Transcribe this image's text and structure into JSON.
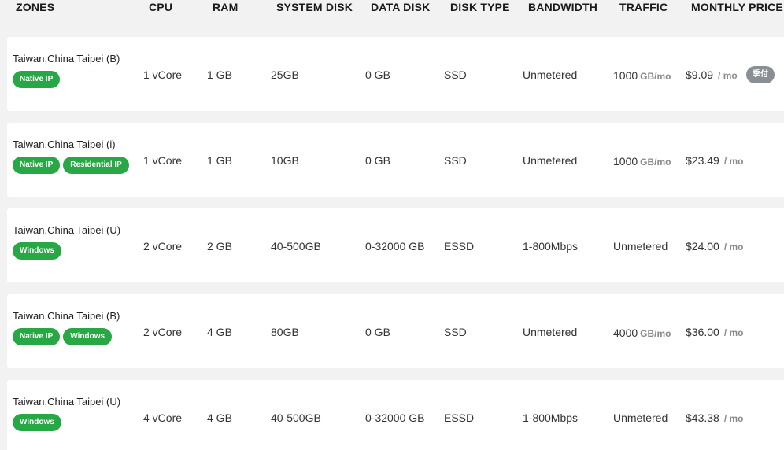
{
  "header": {
    "zones": "ZONES",
    "cpu": "CPU",
    "ram": "RAM",
    "system_disk": "SYSTEM DISK",
    "data_disk": "DATA DISK",
    "disk_type": "DISK TYPE",
    "bandwidth": "BANDWIDTH",
    "traffic": "TRAFFIC",
    "monthly_price": "MONTHLY PRICE"
  },
  "rows": [
    {
      "zone": "Taiwan,China Taipei (B)",
      "tags": [
        "Native IP"
      ],
      "cpu": "1 vCore",
      "ram": "1 GB",
      "system_disk": "25GB",
      "data_disk": "0 GB",
      "disk_type": "SSD",
      "bandwidth": "Unmetered",
      "traffic": "1000",
      "traffic_unit": "GB/mo",
      "price": "$9.09",
      "price_unit": "/ mo",
      "badge": "季付"
    },
    {
      "zone": "Taiwan,China Taipei (i)",
      "tags": [
        "Native IP",
        "Residential IP"
      ],
      "cpu": "1 vCore",
      "ram": "1 GB",
      "system_disk": "10GB",
      "data_disk": "0 GB",
      "disk_type": "SSD",
      "bandwidth": "Unmetered",
      "traffic": "1000",
      "traffic_unit": "GB/mo",
      "price": "$23.49",
      "price_unit": "/ mo",
      "badge": ""
    },
    {
      "zone": "Taiwan,China Taipei (U)",
      "tags": [
        "Windows"
      ],
      "cpu": "2 vCore",
      "ram": "2 GB",
      "system_disk": "40-500GB",
      "data_disk": "0-32000 GB",
      "disk_type": "ESSD",
      "bandwidth": "1-800Mbps",
      "traffic": "Unmetered",
      "traffic_unit": "",
      "price": "$24.00",
      "price_unit": "/ mo",
      "badge": ""
    },
    {
      "zone": "Taiwan,China Taipei (B)",
      "tags": [
        "Native IP",
        "Windows"
      ],
      "cpu": "2 vCore",
      "ram": "4 GB",
      "system_disk": "80GB",
      "data_disk": "0 GB",
      "disk_type": "SSD",
      "bandwidth": "Unmetered",
      "traffic": "4000",
      "traffic_unit": "GB/mo",
      "price": "$36.00",
      "price_unit": "/ mo",
      "badge": ""
    },
    {
      "zone": "Taiwan,China Taipei (U)",
      "tags": [
        "Windows"
      ],
      "cpu": "4 vCore",
      "ram": "4 GB",
      "system_disk": "40-500GB",
      "data_disk": "0-32000 GB",
      "disk_type": "ESSD",
      "bandwidth": "1-800Mbps",
      "traffic": "Unmetered",
      "traffic_unit": "",
      "price": "$43.38",
      "price_unit": "/ mo",
      "badge": ""
    }
  ]
}
